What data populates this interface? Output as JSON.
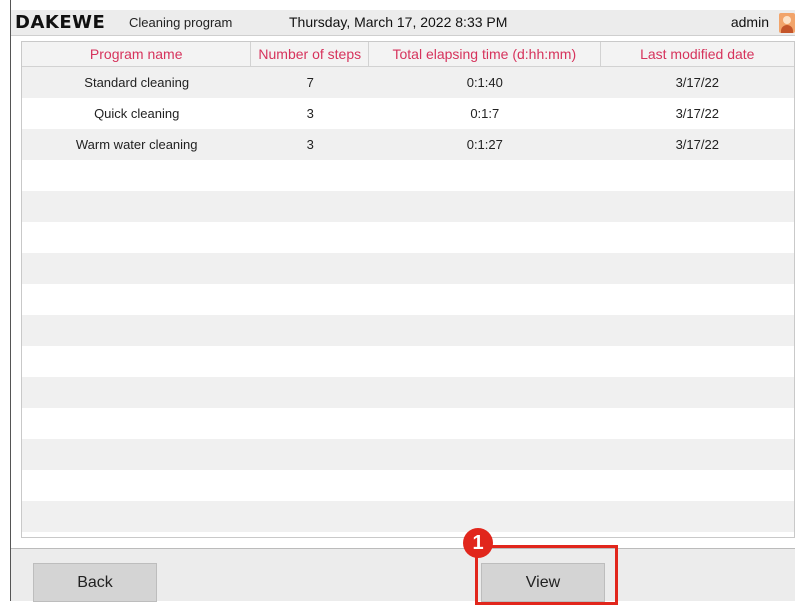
{
  "header": {
    "brand": "DAKEWE",
    "module": "Cleaning program",
    "datetime": "Thursday, March 17, 2022 8:33 PM",
    "user": "admin",
    "avatar_icon": "user-avatar-icon"
  },
  "table": {
    "columns": [
      "Program name",
      "Number of steps",
      "Total elapsing time (d:hh:mm)",
      "Last modified date"
    ],
    "rows": [
      [
        "Standard cleaning",
        "7",
        "0:1:40",
        "3/17/22"
      ],
      [
        "Quick cleaning",
        "3",
        "0:1:7",
        "3/17/22"
      ],
      [
        "Warm water cleaning",
        "3",
        "0:1:27",
        "3/17/22"
      ]
    ],
    "empty_rows": 12
  },
  "footer": {
    "back_label": "Back",
    "view_label": "View"
  },
  "annotation": {
    "marker_number": "1",
    "highlight_color": "#e1261c"
  },
  "colors": {
    "header_text": "#d6335c",
    "accent_red": "#e1261c"
  }
}
